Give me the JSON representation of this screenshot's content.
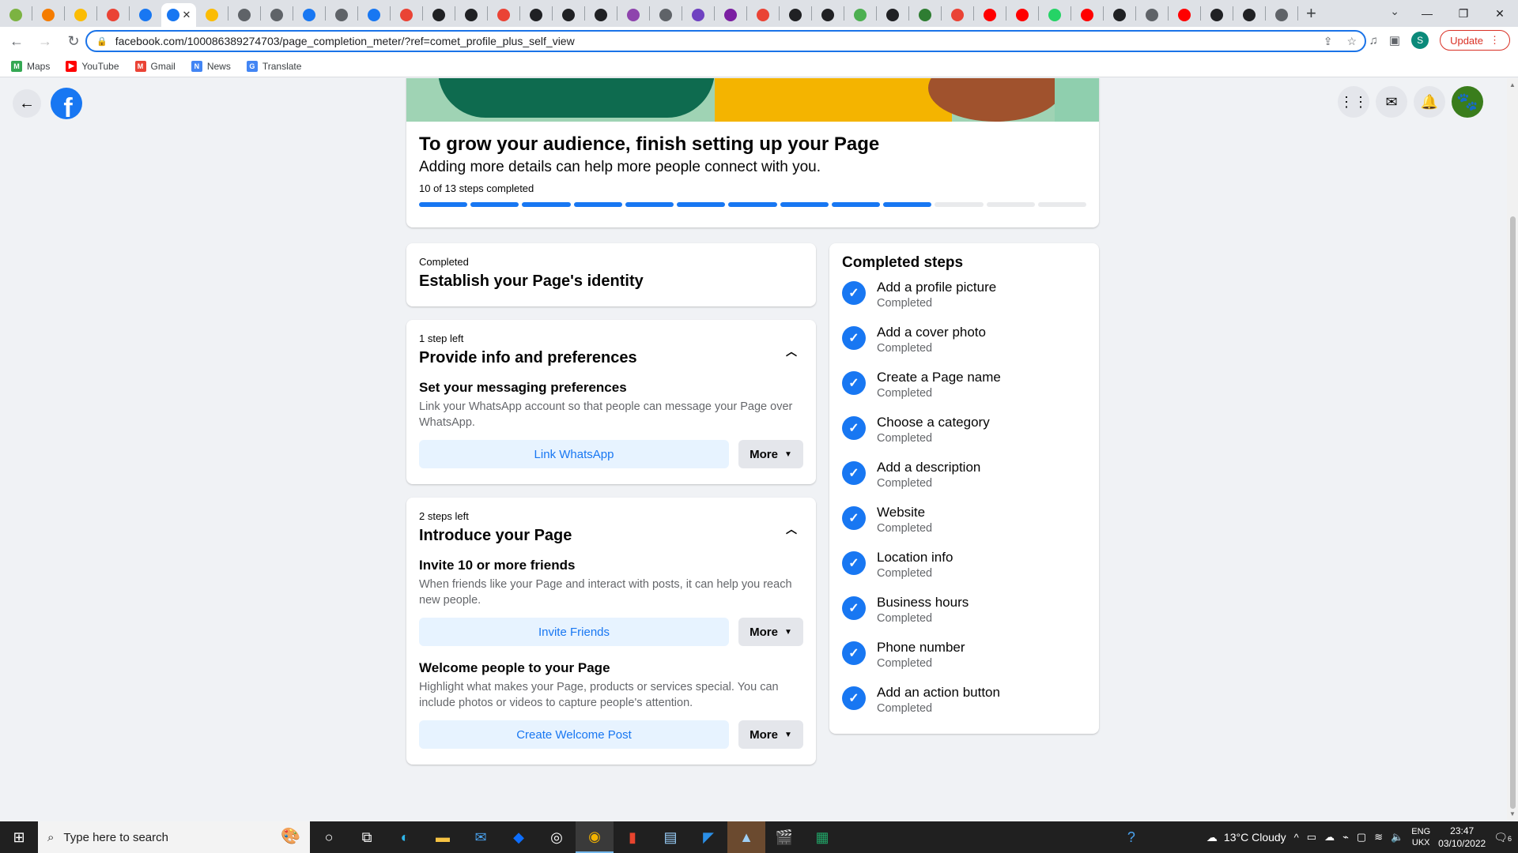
{
  "browser": {
    "tab_close": "✕",
    "new_tab": "+",
    "url": "facebook.com/100086389274703/page_completion_meter/?ref=comet_profile_plus_self_view",
    "profile_initial": "S",
    "update_label": "Update",
    "bookmarks": [
      {
        "label": "Maps",
        "color": "#34a853",
        "glyph": "M"
      },
      {
        "label": "YouTube",
        "color": "#ff0000",
        "glyph": "▶"
      },
      {
        "label": "Gmail",
        "color": "#ea4335",
        "glyph": "M"
      },
      {
        "label": "News",
        "color": "#4285f4",
        "glyph": "N"
      },
      {
        "label": "Translate",
        "color": "#4285f4",
        "glyph": "G"
      }
    ]
  },
  "facebook": {
    "logo_glyph": "f",
    "hero": {
      "title": "To grow your audience, finish setting up your Page",
      "subtitle": "Adding more details can help more people connect with you.",
      "steps_text": "10 of 13 steps completed",
      "completed": 10,
      "total": 13
    },
    "sections": [
      {
        "over": "Completed",
        "title": "Establish your Page's identity"
      },
      {
        "over": "1 step left",
        "title": "Provide info and preferences",
        "tasks": [
          {
            "title": "Set your messaging preferences",
            "desc": "Link your WhatsApp account so that people can message your Page over WhatsApp.",
            "primary": "Link WhatsApp",
            "more": "More"
          }
        ]
      },
      {
        "over": "2 steps left",
        "title": "Introduce your Page",
        "tasks": [
          {
            "title": "Invite 10 or more friends",
            "desc": "When friends like your Page and interact with posts, it can help you reach new people.",
            "primary": "Invite Friends",
            "more": "More"
          },
          {
            "title": "Welcome people to your Page",
            "desc": "Highlight what makes your Page, products or services special. You can include photos or videos to capture people's attention.",
            "primary": "Create Welcome Post",
            "more": "More"
          }
        ]
      }
    ],
    "completed_steps": {
      "title": "Completed steps",
      "status": "Completed",
      "items": [
        "Add a profile picture",
        "Add a cover photo",
        "Create a Page name",
        "Choose a category",
        "Add a description",
        "Website",
        "Location info",
        "Business hours",
        "Phone number",
        "Add an action button"
      ]
    }
  },
  "taskbar": {
    "search_placeholder": "Type here to search",
    "weather": "13°C  Cloudy",
    "lang_top": "ENG",
    "lang_bottom": "UKX",
    "time": "23:47",
    "date": "03/10/2022",
    "notification_count": "6"
  }
}
